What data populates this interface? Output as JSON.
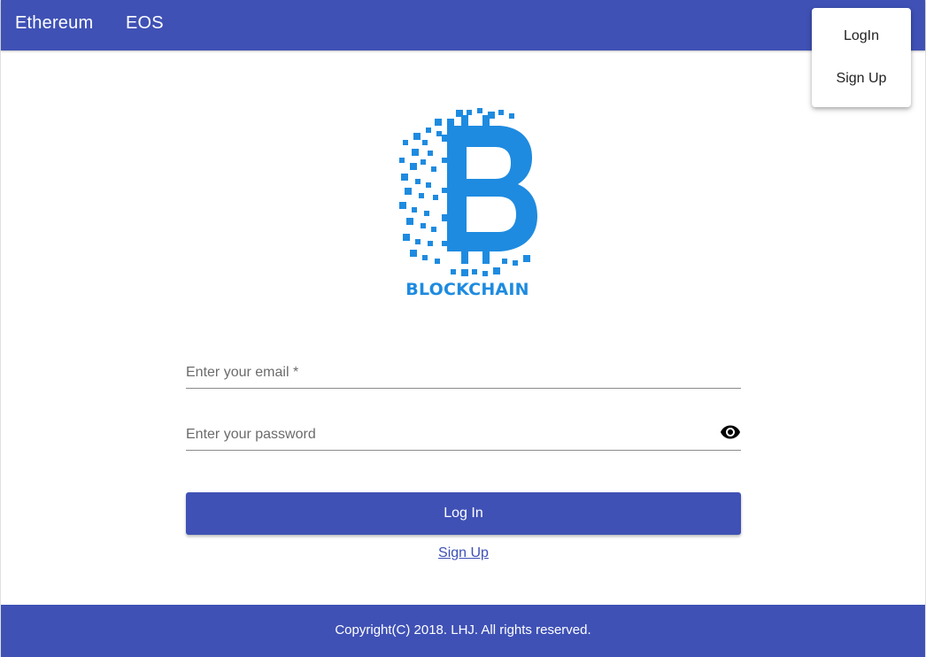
{
  "header": {
    "nav": [
      "Ethereum",
      "EOS"
    ]
  },
  "account_menu": {
    "items": [
      "LogIn",
      "Sign Up"
    ]
  },
  "logo": {
    "text": "BLOCKCHAIN",
    "color": "#1e8be0"
  },
  "form": {
    "email_label": "Enter your email *",
    "email_value": "",
    "password_label": "Enter your password",
    "password_value": "",
    "password_toggle_icon": "eye-icon",
    "submit_label": "Log In",
    "signup_link": "Sign Up"
  },
  "footer": {
    "copyright": "Copyright(C) 2018. LHJ. All rights reserved."
  },
  "colors": {
    "primary": "#3f51b5",
    "logo_blue": "#1e8be0"
  }
}
